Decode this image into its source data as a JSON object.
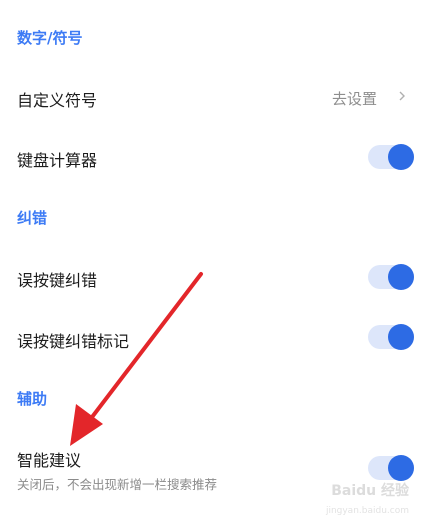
{
  "sections": {
    "numbers_symbols": {
      "title": "数字/符号",
      "custom_symbols": {
        "label": "自定义符号",
        "action": "去设置"
      },
      "keyboard_calculator": {
        "label": "键盘计算器",
        "enabled": true
      }
    },
    "correction": {
      "title": "纠错",
      "typo_correction": {
        "label": "误按键纠错",
        "enabled": true
      },
      "typo_correction_mark": {
        "label": "误按键纠错标记",
        "enabled": true
      }
    },
    "assist": {
      "title": "辅助",
      "smart_suggestion": {
        "label": "智能建议",
        "description": "关闭后，不会出现新增一栏搜索推荐",
        "enabled": true
      }
    }
  },
  "watermark": {
    "text": "Baidu 经验",
    "url": "jingyan.baidu.com"
  },
  "colors": {
    "accent": "#3d7bf5",
    "toggle_track": "#dde6fa",
    "toggle_knob": "#2d6be4",
    "arrow": "#e3262a"
  }
}
